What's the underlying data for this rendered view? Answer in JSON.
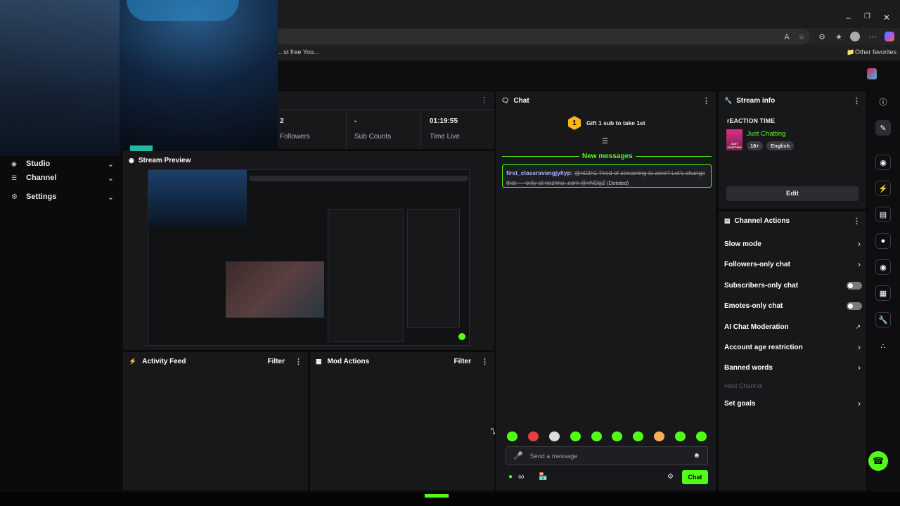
{
  "browser": {
    "favorites_item": "...st free You...",
    "other_favorites": "Other favorites"
  },
  "sidebar": {
    "items": [
      {
        "label": "Studio"
      },
      {
        "label": "Channel"
      },
      {
        "label": "Settings"
      }
    ]
  },
  "stats": [
    {
      "value": "2",
      "label": "Followers"
    },
    {
      "value": "-",
      "label": "Sub Counts"
    },
    {
      "value": "01:19:55",
      "label": "Time Live"
    }
  ],
  "preview": {
    "title": "Stream Preview"
  },
  "activity_feed": {
    "title": "Activity Feed",
    "filter": "Filter"
  },
  "mod_actions": {
    "title": "Mod Actions",
    "filter": "Filter"
  },
  "chat": {
    "title": "Chat",
    "gift_count": "1",
    "gift_text": "Gift 1 sub to take 1st",
    "new_messages": "New messages",
    "message": {
      "user": "first_classravengjyllyp:",
      "text": "@n02h1 Tired of streaming to zero? Let's change that — only at nezhna .com @vNDgZ",
      "status": "(Deleted)"
    },
    "input_placeholder": "Send a message",
    "send_label": "Chat"
  },
  "stream_info": {
    "title": "Stream info",
    "stream_title": "rEACTION TIME",
    "category": "Just Chatting",
    "tags": [
      "18+",
      "English"
    ],
    "edit_label": "Edit",
    "thumb_text": "JUST CHATTING"
  },
  "channel_actions": {
    "title": "Channel Actions",
    "items": [
      {
        "label": "Slow mode",
        "control": "chevron"
      },
      {
        "label": "Followers-only chat",
        "control": "chevron"
      },
      {
        "label": "Subscribers-only chat",
        "control": "toggle"
      },
      {
        "label": "Emotes-only chat",
        "control": "toggle"
      },
      {
        "label": "AI Chat Moderation",
        "control": "external"
      },
      {
        "label": "Account age restriction",
        "control": "chevron"
      },
      {
        "label": "Banned words",
        "control": "chevron"
      },
      {
        "label": "Host Channel",
        "control": "none"
      },
      {
        "label": "Set goals",
        "control": "chevron"
      }
    ]
  },
  "colors": {
    "accent": "#53fc18",
    "panel": "#18181b",
    "background": "#0b0b0c"
  }
}
